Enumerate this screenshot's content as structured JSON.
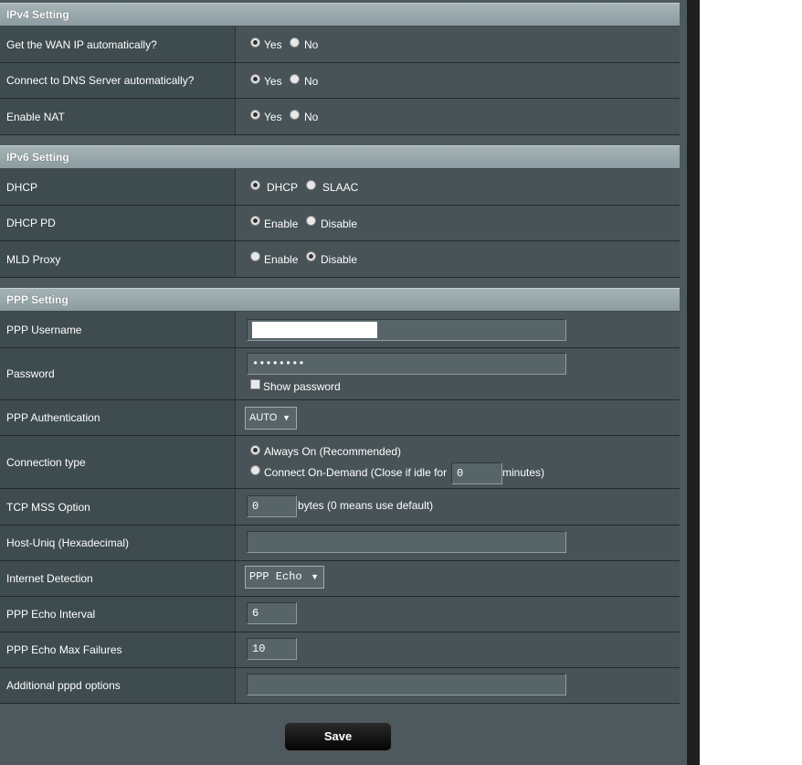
{
  "ipv4": {
    "title": "IPv4 Setting",
    "wan_ip_auto": {
      "label": "Get the WAN IP automatically?",
      "options": [
        "Yes",
        "No"
      ],
      "selected": "Yes"
    },
    "dns_auto": {
      "label": "Connect to DNS Server automatically?",
      "options": [
        "Yes",
        "No"
      ],
      "selected": "Yes"
    },
    "nat": {
      "label": "Enable NAT",
      "options": [
        "Yes",
        "No"
      ],
      "selected": "Yes"
    }
  },
  "ipv6": {
    "title": "IPv6 Setting",
    "dhcp": {
      "label": "DHCP",
      "options": [
        "DHCP",
        "SLAAC"
      ],
      "selected": "DHCP"
    },
    "dhcp_pd": {
      "label": "DHCP PD",
      "options": [
        "Enable",
        "Disable"
      ],
      "selected": "Enable"
    },
    "mld_proxy": {
      "label": "MLD Proxy",
      "options": [
        "Enable",
        "Disable"
      ],
      "selected": "Disable"
    }
  },
  "ppp": {
    "title": "PPP Setting",
    "username": {
      "label": "PPP Username",
      "value": ""
    },
    "password": {
      "label": "Password",
      "value": "••••••••",
      "show_label": "Show password"
    },
    "auth": {
      "label": "PPP Authentication",
      "value": "AUTO"
    },
    "connection": {
      "label": "Connection type",
      "opt_always": "Always On (Recommended)",
      "opt_demand": "Connect On-Demand (Close if idle for",
      "idle_value": "0",
      "idle_suffix": "minutes)",
      "selected": "Always On (Recommended)"
    },
    "mss": {
      "label": "TCP MSS Option",
      "value": "0",
      "suffix": "bytes (0 means use default)"
    },
    "host_uniq": {
      "label": "Host-Uniq (Hexadecimal)",
      "value": ""
    },
    "detection": {
      "label": "Internet Detection",
      "value": "PPP Echo"
    },
    "echo_interval": {
      "label": "PPP Echo Interval",
      "value": "6"
    },
    "echo_max_fail": {
      "label": "PPP Echo Max Failures",
      "value": "10"
    },
    "pppd_options": {
      "label": "Additional pppd options",
      "value": ""
    }
  },
  "save_label": "Save",
  "icons": {
    "dropdown": "chevron-down-icon"
  }
}
